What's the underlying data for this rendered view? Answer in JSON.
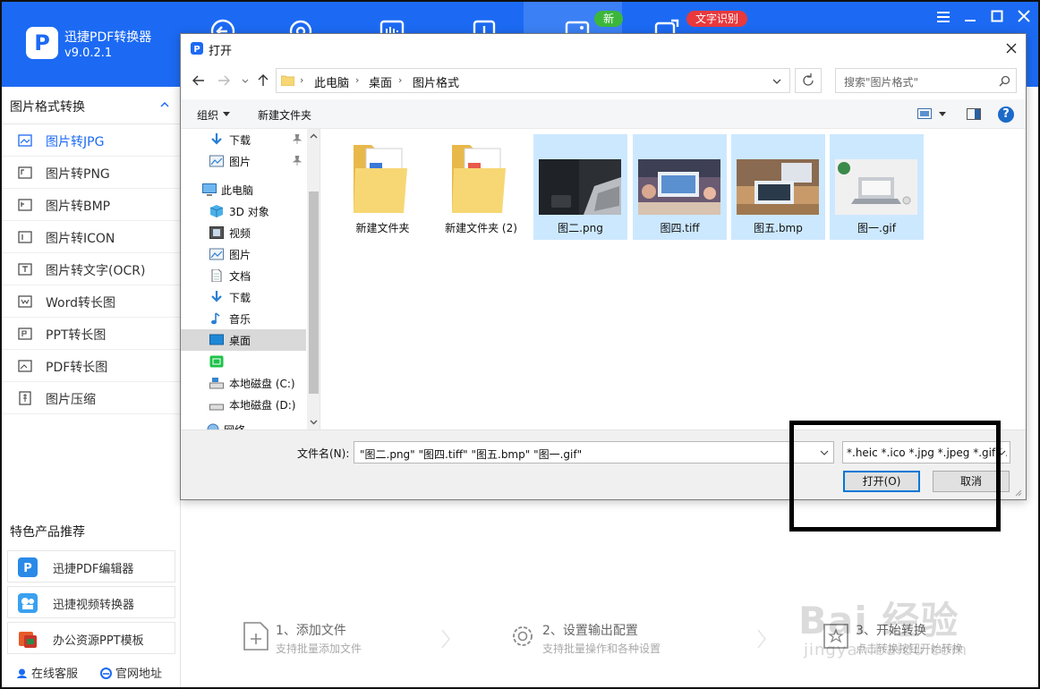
{
  "app": {
    "logo_letter": "P",
    "name": "迅捷PDF转换器",
    "version": "v9.0.2.1",
    "badges": {
      "new": "新",
      "ocr": "文字识别"
    },
    "accent": "#1c6af3"
  },
  "sidebar": {
    "title": "图片格式转换",
    "items": [
      {
        "label": "图片转JPG",
        "active": true
      },
      {
        "label": "图片转PNG"
      },
      {
        "label": "图片转BMP"
      },
      {
        "label": "图片转ICON"
      },
      {
        "label": "图片转文字(OCR)"
      },
      {
        "label": "Word转长图"
      },
      {
        "label": "PPT转长图"
      },
      {
        "label": "PDF转长图"
      },
      {
        "label": "图片压缩"
      }
    ],
    "featured_title": "特色产品推荐",
    "featured": [
      {
        "label": "迅捷PDF编辑器"
      },
      {
        "label": "迅捷视频转换器"
      },
      {
        "label": "办公资源PPT模板"
      }
    ],
    "footer": {
      "service": "在线客服",
      "website": "官网地址"
    }
  },
  "steps": [
    {
      "title": "1、添加文件",
      "desc": "支持批量添加文件"
    },
    {
      "title": "2、设置输出配置",
      "desc": "支持批量操作和各种设置"
    },
    {
      "title": "3、开始转换",
      "desc": "点击转换按钮开始转换"
    }
  ],
  "watermark": {
    "brand": "Bai 经验",
    "url": "jingyan.baidu.com"
  },
  "dialog": {
    "title": "打开",
    "breadcrumb": [
      "此电脑",
      "桌面",
      "图片格式"
    ],
    "search_placeholder": "搜索\"图片格式\"",
    "toolbar": {
      "organize": "组织",
      "new_folder": "新建文件夹"
    },
    "help": "?",
    "nav": {
      "quick_download": "下载",
      "quick_pictures": "图片",
      "this_pc": "此电脑",
      "objects_3d": "3D 对象",
      "videos": "视频",
      "pictures": "图片",
      "documents": "文档",
      "downloads": "下载",
      "music": "音乐",
      "desktop": "桌面",
      "drive_c": "本地磁盘 (C:)",
      "drive_d": "本地磁盘 (D:)",
      "network": "网络"
    },
    "files": [
      {
        "name": "新建文件夹",
        "type": "folder"
      },
      {
        "name": "新建文件夹 (2)",
        "type": "folder"
      },
      {
        "name": "图二.png",
        "type": "image",
        "selected": true
      },
      {
        "name": "图四.tiff",
        "type": "image",
        "selected": true
      },
      {
        "name": "图五.bmp",
        "type": "image",
        "selected": true
      },
      {
        "name": "图一.gif",
        "type": "image",
        "selected": true
      }
    ],
    "filename_label": "文件名(N):",
    "filename_value": "\"图二.png\" \"图四.tiff\" \"图五.bmp\" \"图一.gif\"",
    "filter_value": "*.heic *.ico *.jpg *.jpeg *.gif *.",
    "open_button": "打开(O)",
    "cancel_button": "取消"
  }
}
